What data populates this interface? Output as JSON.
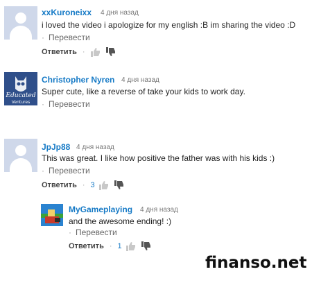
{
  "comments": [
    {
      "author": "xxKuroneixx",
      "time": "4 дня назад",
      "text": "i loved the video i apologize for my english :B im sharing the video :D",
      "translate": "Перевести",
      "reply": "Ответить",
      "likes": "",
      "avatar_icon": "default-user-avatar"
    },
    {
      "author": "Christopher Nyren",
      "time": "4 дня назад",
      "text": "Super cute, like a reverse of take your kids to work day.",
      "translate": "Перевести",
      "avatar_icon": "educated-ventures-logo",
      "avatar_line1": "Educated",
      "avatar_line2": "Ventures"
    },
    {
      "author": "JpJp88",
      "time": "4 дня назад",
      "text": "This was great.   I like how positive the father was with his kids :)",
      "translate": "Перевести",
      "reply": "Ответить",
      "likes": "3",
      "avatar_icon": "default-user-avatar"
    }
  ],
  "reply_comment": {
    "author": "MyGameplaying",
    "time": "4 дня назад",
    "text": "and the awesome ending! :)",
    "translate": "Перевести",
    "reply": "Ответить",
    "likes": "1",
    "avatar_icon": "game-avatar"
  },
  "watermark": "finanso.net",
  "colors": {
    "author": "#167ac6",
    "text": "#222222",
    "muted": "#777777"
  }
}
